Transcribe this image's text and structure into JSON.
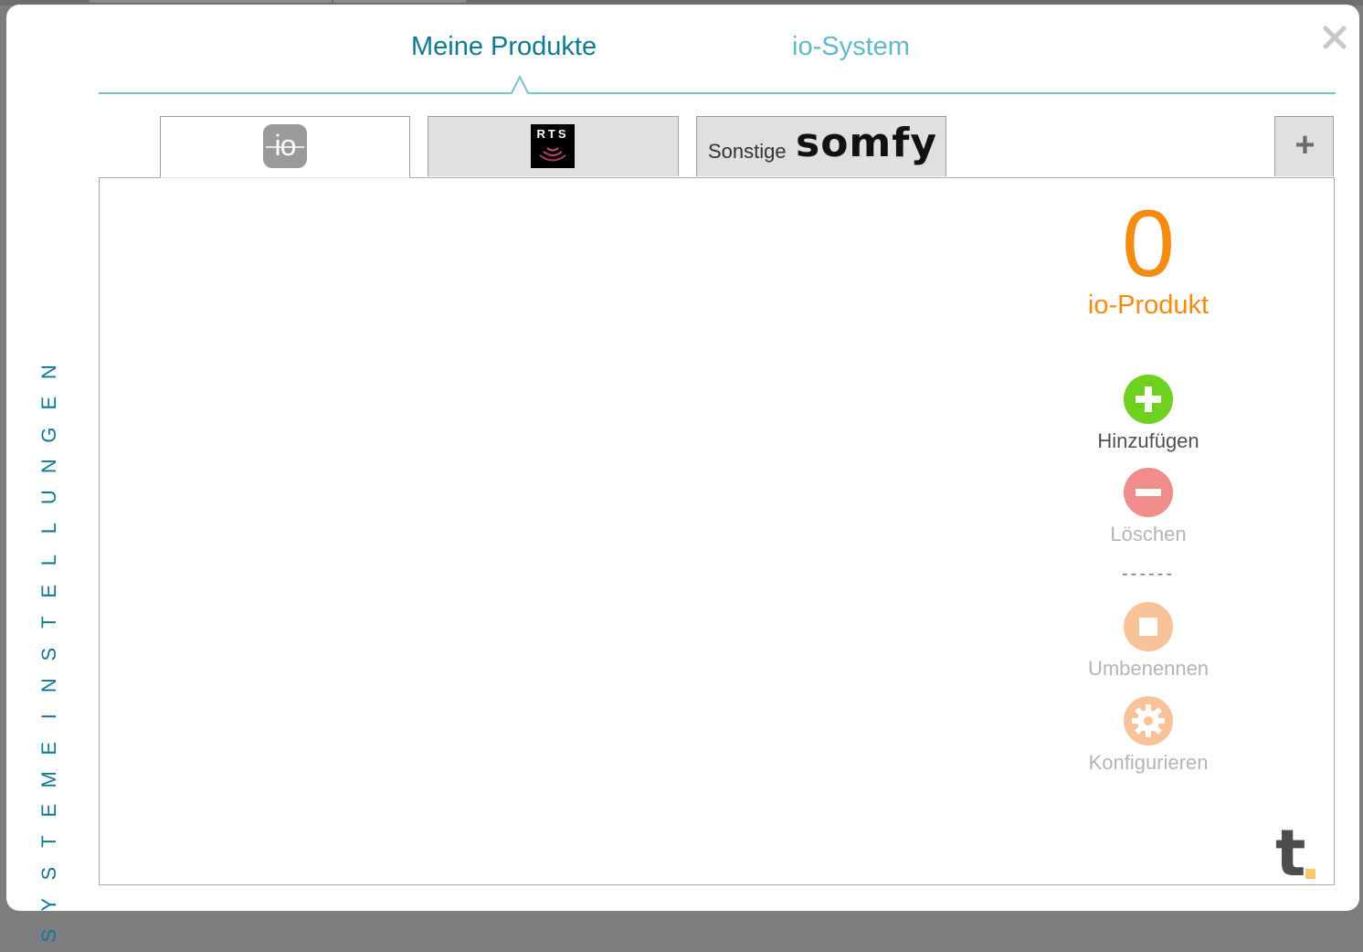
{
  "tabs": {
    "active_label": "Meine Produkte",
    "inactive_label": "io-System"
  },
  "sidebar": {
    "title_letters": [
      "S",
      "Y",
      "S",
      "T",
      "E",
      "M",
      "E",
      "I",
      "N",
      "S",
      "T",
      "E",
      "L",
      "L",
      "U",
      "N",
      "G",
      "E",
      "N"
    ]
  },
  "product_tabs": {
    "io_logo": "io",
    "rts_logo": "RTS",
    "other_label": "Sonstige",
    "other_brand": "somfy",
    "add_label": "+"
  },
  "summary": {
    "count": "0",
    "label": "io-Produkt"
  },
  "actions": {
    "add": "Hinzufügen",
    "delete": "Löschen",
    "divider": "------",
    "rename": "Umbenennen",
    "configure": "Konfigurieren"
  },
  "brand": {
    "letter": "t"
  },
  "colors": {
    "teal": "#0b7a92",
    "teal_light": "#62b9c6",
    "orange": "#f48b10",
    "green": "#6ed11f",
    "red_light": "#f08c8c",
    "orange_light": "#f8c197"
  },
  "icons": {
    "close": "close-icon",
    "add": "plus-circle-icon",
    "delete": "minus-circle-icon",
    "rename": "stop-square-icon",
    "configure": "gear-icon"
  }
}
